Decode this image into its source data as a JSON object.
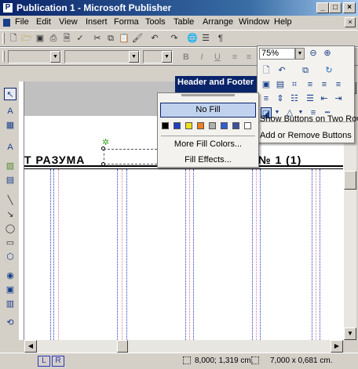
{
  "window": {
    "app_icon": "publisher-icon",
    "title": "Publication 1 - Microsoft Publisher",
    "controls": {
      "minimize": "_",
      "maximize": "□",
      "close": "×"
    }
  },
  "menu": {
    "items": [
      "File",
      "Edit",
      "View",
      "Insert",
      "Forma",
      "Tools",
      "Table",
      "Arrange",
      "Window",
      "Help"
    ],
    "mdi": {
      "close": "×"
    }
  },
  "toolbar_standard": {
    "icons": [
      "new-icon",
      "open-icon",
      "save-icon",
      "print-icon",
      "print-preview-icon",
      "spelling-icon",
      "cut-icon",
      "copy-icon",
      "paste-icon",
      "format-painter-icon",
      "undo-icon",
      "redo-icon",
      "insert-hyperlink-icon",
      "columns-icon",
      "special-characters-icon"
    ],
    "zoom": "75%",
    "zoom_in_icon": "zoom-in-icon",
    "zoom_out_icon": "zoom-out-icon"
  },
  "toolbar_formatting": {
    "style_combo": "",
    "font_combo": "",
    "size_combo": "",
    "bold": "B",
    "italic": "I",
    "underline": "U"
  },
  "header_footer": {
    "title": "Header and Footer"
  },
  "fill_menu": {
    "no_fill": "No Fill",
    "swatches": [
      "#000000",
      "#1f3fbf",
      "#f0e020",
      "#f08020",
      "#b0b0b0",
      "#3060d0",
      "#4050a0",
      "#ffffff"
    ],
    "more_colors": "More Fill Colors...",
    "fill_effects": "Fill Effects..."
  },
  "format_dropdown": {
    "zoom": "75%",
    "show_two_rows": "Show Buttons on Two Rows",
    "add_remove": "Add or Remove Buttons"
  },
  "document": {
    "header_left": "Т РАЗУМА",
    "header_right": "№ 1 (1)"
  },
  "statusbar": {
    "page_l": "L",
    "page_r": "R",
    "position": "8,000; 1,319 cm.",
    "size": "7,000 x 0,681 cm."
  },
  "colors": {
    "titlebar": "#0a246a",
    "guide_blue": "#2a36b8",
    "guide_pink": "#d07aa0"
  }
}
